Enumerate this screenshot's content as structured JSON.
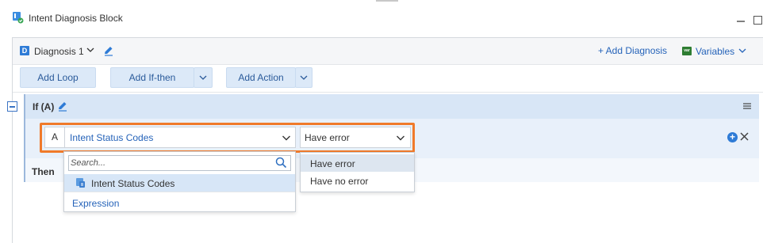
{
  "window": {
    "title": "Intent Diagnosis Block",
    "icons": {
      "app": "flow-block-icon",
      "minimize": "minimize-icon",
      "maximize": "maximize-icon"
    }
  },
  "header": {
    "diagnosis_badge": "D",
    "diagnosis_name": "Diagnosis 1",
    "add_diagnosis": "+ Add Diagnosis",
    "variables_badge": "var",
    "variables_label": "Variables"
  },
  "toolbar": {
    "add_loop": "Add Loop",
    "add_ifthen": "Add If-then",
    "add_action": "Add Action"
  },
  "if_block": {
    "label": "If (A)",
    "then_label": "Then",
    "condition": {
      "letter": "A",
      "field_value": "Intent Status Codes",
      "operator_value": "Have error"
    }
  },
  "field_dropdown": {
    "search_placeholder": "Search...",
    "items": [
      {
        "label": "Intent Status Codes",
        "selected": true
      },
      {
        "label": "Expression",
        "selected": false
      }
    ]
  },
  "operator_dropdown": {
    "options": [
      {
        "label": "Have error",
        "selected": true
      },
      {
        "label": "Have no error",
        "selected": false
      }
    ]
  },
  "colors": {
    "accent_blue": "#2563b9",
    "highlight_orange": "#f07a2a",
    "button_bg": "#dce9f8",
    "if_block_bg": "#d8e6f6",
    "variables_green": "#2e7d32"
  }
}
